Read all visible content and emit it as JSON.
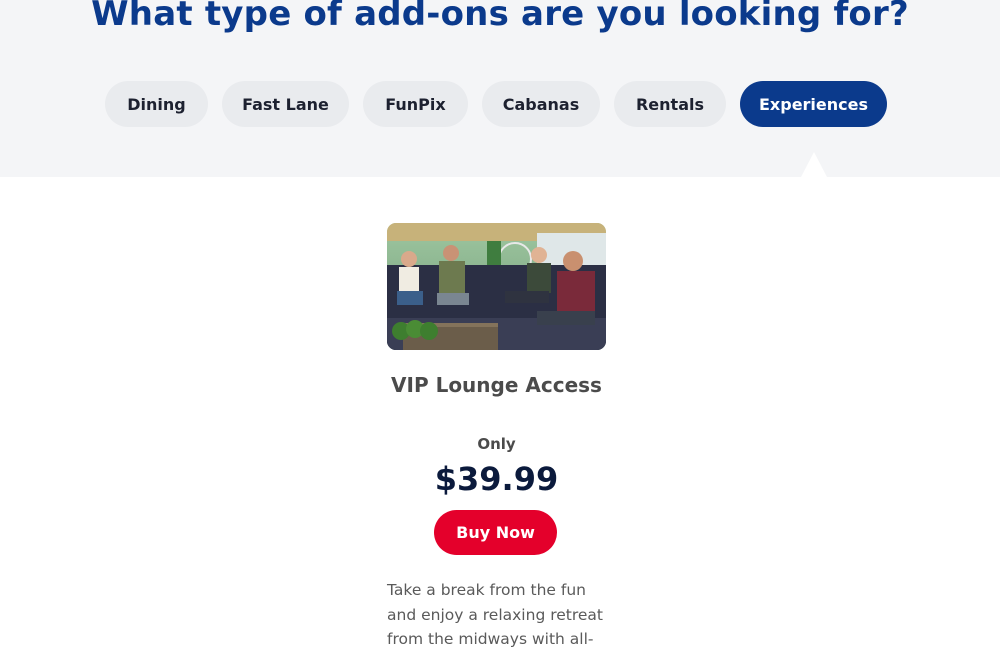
{
  "header": {
    "title": "What type of add-ons are you looking for?"
  },
  "tabs": [
    {
      "label": "Dining",
      "active": false
    },
    {
      "label": "Fast Lane",
      "active": false
    },
    {
      "label": "FunPix",
      "active": false
    },
    {
      "label": "Cabanas",
      "active": false
    },
    {
      "label": "Rentals",
      "active": false
    },
    {
      "label": "Experiences",
      "active": true
    }
  ],
  "card": {
    "image_icon": "photo-of-guests-in-vip-lounge",
    "title": "VIP Lounge Access",
    "price_prefix": "Only",
    "price": "$39.99",
    "button_label": "Buy Now",
    "description": "Take a break from the fun and enjoy a relaxing retreat from the midways with all-"
  },
  "colors": {
    "brand_blue": "#0b3a8c",
    "buy_red": "#e4002b",
    "band_bg": "#f4f5f7",
    "tab_bg": "#e9ebee"
  }
}
